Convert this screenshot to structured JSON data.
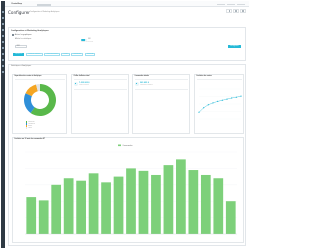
{
  "brand": {
    "name": "PrestaShop",
    "accent": "#25b9d7",
    "logo_color": "#df0067"
  },
  "header": {
    "title": "Configurer",
    "subtitle": "Configuration et Marketing Analytiques"
  },
  "config": {
    "heading": "Configuration et Marketing Analytiques",
    "enable_label": "Activer les graphiques",
    "field_label": "Afficher les statistiques",
    "toggle_state": "OUI",
    "help_text": "Afficher les donnees",
    "date_value": "2021",
    "save_label": "Enregistrer",
    "tabs": [
      "Statistiques",
      "Ventes par categorie",
      "Ventes par produit",
      "Clients",
      "Commandes",
      "Paiements"
    ]
  },
  "dashboard": {
    "heading": "Statistiques et Analytiques",
    "pie_title": "Repartition des ventes et Analytique",
    "stats": [
      {
        "title": "Chiffre d'affaires total",
        "value": "7 452 000 $",
        "label": "Chiffre d'affaires"
      },
      {
        "title": "Commandes totales",
        "value": "245 455 $",
        "label": "Commandes passees"
      }
    ],
    "line_title": "Evolution des ventes",
    "bar_title": "Evolution sur 12 mois des commandes HT",
    "bar_legend": "Commandes"
  },
  "chart_data": [
    {
      "type": "pie",
      "categories": [
        "Vetements",
        "Accessoires",
        "Maison",
        "Autres"
      ],
      "values": [
        60,
        22,
        14,
        4
      ],
      "colors": [
        "#59b84a",
        "#2f8fd8",
        "#f5a623",
        "#e1e5e8"
      ]
    },
    {
      "type": "line",
      "x": [
        1,
        2,
        3,
        4,
        5,
        6,
        7,
        8,
        9,
        10
      ],
      "values": [
        18,
        30,
        38,
        43,
        47,
        50,
        53,
        56,
        58,
        61
      ],
      "ylim": [
        0,
        80
      ],
      "color": "#25b9d7",
      "grid": true
    },
    {
      "type": "bar",
      "categories": [
        "1",
        "2",
        "3",
        "4",
        "5",
        "6",
        "7",
        "8",
        "9",
        "10",
        "11",
        "12",
        "13",
        "14",
        "15",
        "16",
        "17"
      ],
      "values": [
        45,
        41,
        60,
        68,
        65,
        74,
        63,
        70,
        80,
        77,
        72,
        84,
        91,
        78,
        72,
        68,
        40
      ],
      "ylim": [
        0,
        100
      ],
      "color": "#7dd07a",
      "grid": true
    }
  ]
}
